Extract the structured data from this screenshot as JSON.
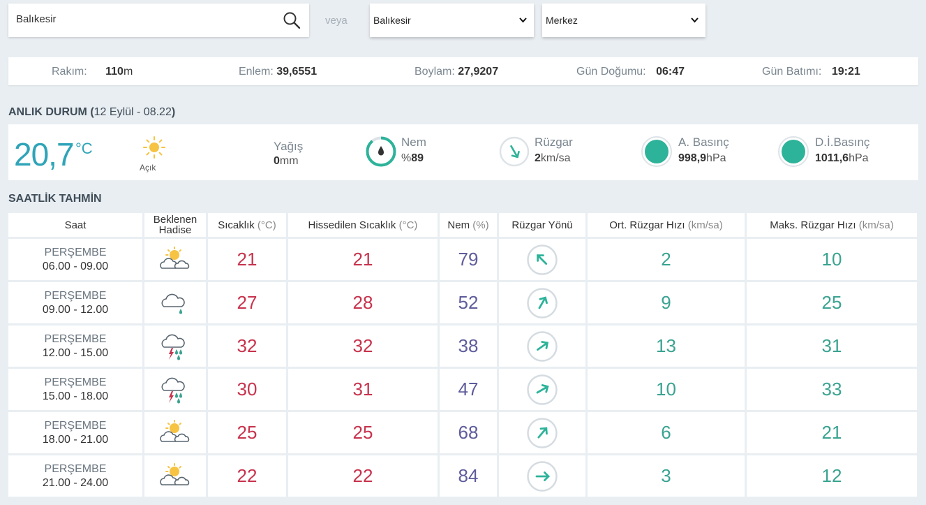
{
  "search": {
    "value": "Balıkesir"
  },
  "or_label": "veya",
  "province_select": {
    "selected": "Balıkesir"
  },
  "district_select": {
    "selected": "Merkez"
  },
  "location": {
    "altitude_label": "Rakım:",
    "altitude_value": "110",
    "altitude_unit": "m",
    "lat_label": "Enlem:",
    "lat_value": "39,6551",
    "lon_label": "Boylam:",
    "lon_value": "27,9207",
    "sunrise_label": "Gün Doğumu:",
    "sunrise_value": "06:47",
    "sunset_label": "Gün Batımı:",
    "sunset_value": "19:21"
  },
  "current": {
    "title": "ANLIK DURUM",
    "paren_open": "(",
    "date": "12 Eylül - 08.22",
    "paren_close": ")",
    "temp": "20,7",
    "temp_unit": "°C",
    "condition_icon": "sun-icon",
    "condition": "Açık",
    "precip_label": "Yağış",
    "precip_value": "0",
    "precip_unit": "mm",
    "humidity_label": "Nem",
    "humidity_prefix": "%",
    "humidity_value": "89",
    "wind_label": "Rüzgar",
    "wind_value": "2",
    "wind_unit": "km/sa",
    "pressure_label": "A. Basınç",
    "pressure_value": "998,9",
    "pressure_unit": "hPa",
    "sea_pressure_label": "D.İ.Basınç",
    "sea_pressure_value": "1011,6",
    "sea_pressure_unit": "hPa",
    "colors": {
      "temp": "#2fa4b8",
      "ring": "#2db39a"
    }
  },
  "hourly": {
    "title": "SAATLİK TAHMİN",
    "headers": {
      "time": "Saat",
      "event": "Beklenen Hadise",
      "temp": "Sıcaklık",
      "temp_unit": "(°C)",
      "feels": "Hissedilen Sıcaklık",
      "feels_unit": "(°C)",
      "humidity": "Nem",
      "humidity_unit": "(%)",
      "wind_dir": "Rüzgar Yönü",
      "avg_wind": "Ort. Rüzgar Hızı",
      "avg_wind_unit": "(km/sa)",
      "max_wind": "Maks. Rüzgar Hızı",
      "max_wind_unit": "(km/sa)"
    },
    "rows": [
      {
        "day": "PERŞEMBE",
        "time": "06.00 - 09.00",
        "icon": "partly-cloudy-icon",
        "temp": "21",
        "feels": "21",
        "humidity": "79",
        "wind_dir_icon": "arrow-northwest-icon",
        "wind_angle": -45,
        "avg_wind": "2",
        "max_wind": "10"
      },
      {
        "day": "PERŞEMBE",
        "time": "09.00 - 12.00",
        "icon": "cloud-rain-icon",
        "temp": "27",
        "feels": "28",
        "humidity": "52",
        "wind_dir_icon": "arrow-northeast-icon",
        "wind_angle": 30,
        "avg_wind": "9",
        "max_wind": "25"
      },
      {
        "day": "PERŞEMBE",
        "time": "12.00 - 15.00",
        "icon": "thunderstorm-icon",
        "temp": "32",
        "feels": "32",
        "humidity": "38",
        "wind_dir_icon": "arrow-northeast-icon",
        "wind_angle": 55,
        "avg_wind": "13",
        "max_wind": "31"
      },
      {
        "day": "PERŞEMBE",
        "time": "15.00 - 18.00",
        "icon": "thunderstorm-icon",
        "temp": "30",
        "feels": "31",
        "humidity": "47",
        "wind_dir_icon": "arrow-northeast-icon",
        "wind_angle": 60,
        "avg_wind": "10",
        "max_wind": "33"
      },
      {
        "day": "PERŞEMBE",
        "time": "18.00 - 21.00",
        "icon": "partly-cloudy-icon",
        "temp": "25",
        "feels": "25",
        "humidity": "68",
        "wind_dir_icon": "arrow-northeast-icon",
        "wind_angle": 40,
        "avg_wind": "6",
        "max_wind": "21"
      },
      {
        "day": "PERŞEMBE",
        "time": "21.00 - 24.00",
        "icon": "partly-cloudy-icon",
        "temp": "22",
        "feels": "22",
        "humidity": "84",
        "wind_dir_icon": "arrow-east-icon",
        "wind_angle": 90,
        "avg_wind": "3",
        "max_wind": "12"
      }
    ]
  }
}
